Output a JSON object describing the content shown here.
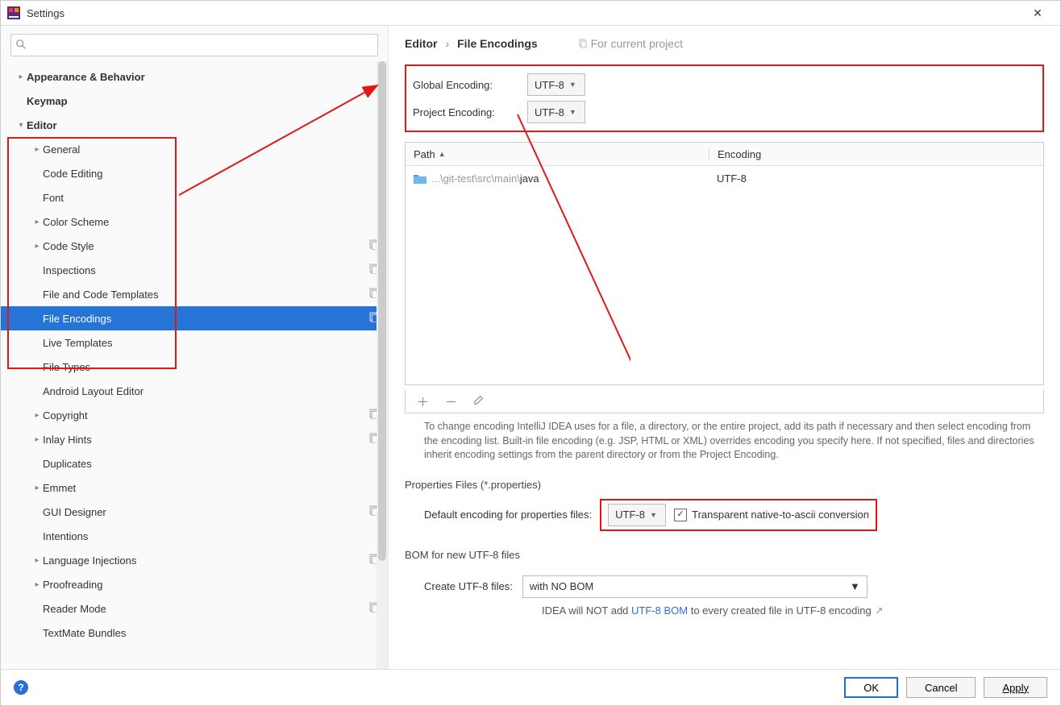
{
  "window": {
    "title": "Settings"
  },
  "search": {
    "placeholder": ""
  },
  "tree": [
    {
      "label": "Appearance & Behavior",
      "depth": 0,
      "arrow": "right",
      "bold": true
    },
    {
      "label": "Keymap",
      "depth": 0,
      "arrow": "",
      "bold": true
    },
    {
      "label": "Editor",
      "depth": 0,
      "arrow": "down",
      "bold": true
    },
    {
      "label": "General",
      "depth": 1,
      "arrow": "right"
    },
    {
      "label": "Code Editing",
      "depth": 1,
      "arrow": ""
    },
    {
      "label": "Font",
      "depth": 1,
      "arrow": ""
    },
    {
      "label": "Color Scheme",
      "depth": 1,
      "arrow": "right"
    },
    {
      "label": "Code Style",
      "depth": 1,
      "arrow": "right",
      "badge": true
    },
    {
      "label": "Inspections",
      "depth": 1,
      "arrow": "",
      "badge": true
    },
    {
      "label": "File and Code Templates",
      "depth": 1,
      "arrow": "",
      "badge": true
    },
    {
      "label": "File Encodings",
      "depth": 1,
      "arrow": "",
      "badge": true,
      "selected": true
    },
    {
      "label": "Live Templates",
      "depth": 1,
      "arrow": ""
    },
    {
      "label": "File Types",
      "depth": 1,
      "arrow": ""
    },
    {
      "label": "Android Layout Editor",
      "depth": 1,
      "arrow": ""
    },
    {
      "label": "Copyright",
      "depth": 1,
      "arrow": "right",
      "badge": true
    },
    {
      "label": "Inlay Hints",
      "depth": 1,
      "arrow": "right",
      "badge": true
    },
    {
      "label": "Duplicates",
      "depth": 1,
      "arrow": ""
    },
    {
      "label": "Emmet",
      "depth": 1,
      "arrow": "right"
    },
    {
      "label": "GUI Designer",
      "depth": 1,
      "arrow": "",
      "badge": true
    },
    {
      "label": "Intentions",
      "depth": 1,
      "arrow": ""
    },
    {
      "label": "Language Injections",
      "depth": 1,
      "arrow": "right",
      "badge": true
    },
    {
      "label": "Proofreading",
      "depth": 1,
      "arrow": "right"
    },
    {
      "label": "Reader Mode",
      "depth": 1,
      "arrow": "",
      "badge": true
    },
    {
      "label": "TextMate Bundles",
      "depth": 1,
      "arrow": ""
    }
  ],
  "breadcrumb": {
    "root": "Editor",
    "leaf": "File Encodings",
    "scope": "For current project"
  },
  "encoding": {
    "globalLabel": "Global Encoding:",
    "globalValue": "UTF-8",
    "projectLabel": "Project Encoding:",
    "projectValue": "UTF-8"
  },
  "table": {
    "headPath": "Path",
    "headEnc": "Encoding",
    "rows": [
      {
        "pathGrey": "...\\git-test\\src\\main\\",
        "pathEnd": "java",
        "enc": "UTF-8"
      }
    ]
  },
  "helpText": "To change encoding IntelliJ IDEA uses for a file, a directory, or the entire project, add its path if necessary and then select encoding from the encoding list. Built-in file encoding (e.g. JSP, HTML or XML) overrides encoding you specify here. If not specified, files and directories inherit encoding settings from the parent directory or from the Project Encoding.",
  "props": {
    "sectionTitle": "Properties Files (*.properties)",
    "label": "Default encoding for properties files:",
    "value": "UTF-8",
    "checkboxLabel": "Transparent native-to-ascii conversion",
    "checked": true
  },
  "bom": {
    "sectionTitle": "BOM for new UTF-8 files",
    "label": "Create UTF-8 files:",
    "value": "with NO BOM",
    "hintPre": "IDEA will NOT add ",
    "hintLink": "UTF-8 BOM",
    "hintPost": " to every created file in UTF-8 encoding"
  },
  "buttons": {
    "ok": "OK",
    "cancel": "Cancel",
    "apply": "Apply"
  }
}
